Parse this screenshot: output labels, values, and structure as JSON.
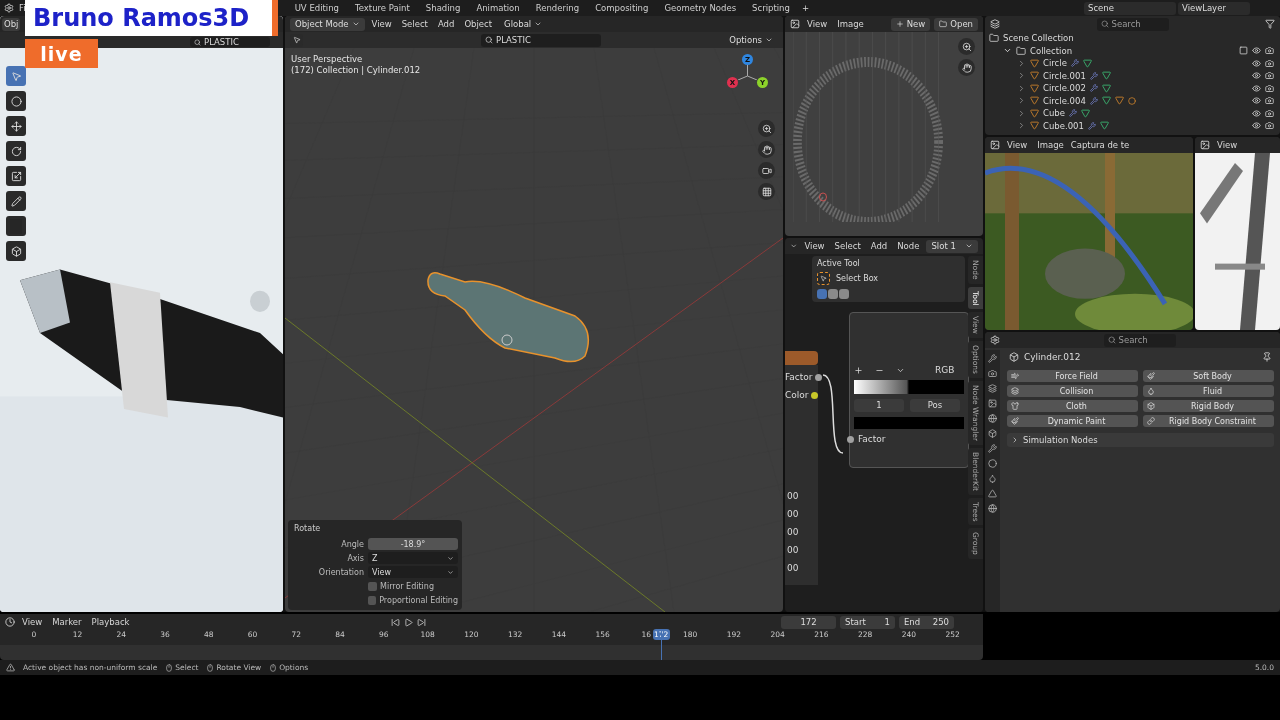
{
  "overlay": {
    "title": "Bruno Ramos3D",
    "badge": "live"
  },
  "top_bar": {
    "file_menu": "Fi",
    "workspace_tabs": [
      {
        "label": "UV Editing",
        "selected": false
      },
      {
        "label": "Texture Paint",
        "selected": false
      },
      {
        "label": "Shading",
        "selected": false
      },
      {
        "label": "Animation",
        "selected": false
      },
      {
        "label": "Rendering",
        "selected": false
      },
      {
        "label": "Compositing",
        "selected": false
      },
      {
        "label": "Geometry Nodes",
        "selected": false
      },
      {
        "label": "Scripting",
        "selected": false
      }
    ],
    "add_tab": "+",
    "scene": "Scene",
    "view_layer": "ViewLayer"
  },
  "render_viewport": {
    "mode": "Obj",
    "search": "PLASTIC"
  },
  "viewport": {
    "mode": "Object Mode",
    "menus": [
      "View",
      "Select",
      "Add",
      "Object"
    ],
    "orientation": "Global",
    "search": "PLASTIC",
    "options": "Options",
    "info": [
      "User Perspective",
      "(172) Collection | Cylinder.012"
    ],
    "gizmo": [
      "X",
      "Y",
      "Z"
    ]
  },
  "rotate_panel": {
    "title": "Rotate",
    "fields": [
      {
        "label": "Angle",
        "value": "-18.9°",
        "kind": "number"
      },
      {
        "label": "Axis",
        "value": "Z",
        "kind": "dropdown"
      },
      {
        "label": "Orientation",
        "value": "View",
        "kind": "dropdown"
      }
    ],
    "checkboxes": [
      {
        "label": "Mirror Editing",
        "checked": false
      },
      {
        "label": "Proportional Editing",
        "checked": false
      }
    ]
  },
  "image_editor": {
    "menus": [
      "View",
      "Image"
    ],
    "new": "New",
    "open": "Open"
  },
  "node_editor": {
    "menus": [
      "View",
      "Select",
      "Add",
      "Node"
    ],
    "slot": "Slot 1",
    "active_tool": {
      "title": "Active Tool",
      "tool": "Select Box"
    },
    "sockets": [
      {
        "label": "Factor",
        "color": "#a1a1a1"
      },
      {
        "label": "Color",
        "color": "#c7c729"
      }
    ],
    "ramp": {
      "mode": "RGB",
      "index": "1",
      "interpolation": "Pos"
    },
    "output": "Factor",
    "values": [
      "00",
      "00",
      "00",
      "00",
      "00"
    ],
    "side_tabs": [
      {
        "label": "Node",
        "selected": false
      },
      {
        "label": "Tool",
        "selected": true
      },
      {
        "label": "View",
        "selected": false
      },
      {
        "label": "Options",
        "selected": false
      },
      {
        "label": "Node Wrangler",
        "selected": false
      },
      {
        "label": "BlenderKit",
        "selected": false
      },
      {
        "label": "Trees",
        "selected": false
      },
      {
        "label": "Group",
        "selected": false
      }
    ]
  },
  "outliner": {
    "search_placeholder": "Search",
    "tree": [
      {
        "name": "Scene Collection",
        "kind": "root",
        "children": [
          {
            "name": "Collection",
            "kind": "collection",
            "expanded": true,
            "children": [
              {
                "name": "Circle",
                "kind": "object",
                "expanded": false,
                "material": false
              },
              {
                "name": "Circle.001",
                "kind": "object",
                "expanded": false,
                "material": false
              },
              {
                "name": "Circle.002",
                "kind": "object",
                "expanded": false,
                "material": false
              },
              {
                "name": "Circle.004",
                "kind": "object",
                "expanded": false,
                "material": true
              },
              {
                "name": "Cube",
                "kind": "object",
                "expanded": false,
                "material": false
              },
              {
                "name": "Cube.001",
                "kind": "object",
                "expanded": false,
                "material": false
              }
            ]
          }
        ]
      }
    ]
  },
  "image_views": [
    {
      "menus": [
        "View",
        "Image"
      ],
      "name": "Captura de te"
    },
    {
      "menus": [
        "View"
      ]
    }
  ],
  "properties": {
    "search_placeholder": "Search",
    "object": "Cylinder.012",
    "buttons": [
      "Force Field",
      "Soft Body",
      "Collision",
      "Fluid",
      "Cloth",
      "Rigid Body",
      "Dynamic Paint",
      "Rigid Body Constraint"
    ],
    "section": "Simulation Nodes"
  },
  "timeline": {
    "menus": [
      "View",
      "Marker",
      "Playback"
    ],
    "current": "172",
    "start_label": "Start",
    "start": "1",
    "end_label": "End",
    "end": "250",
    "ticks": [
      "0",
      "12",
      "24",
      "36",
      "48",
      "60",
      "72",
      "84",
      "96",
      "108",
      "120",
      "132",
      "144",
      "156",
      "16",
      "180",
      "192",
      "204",
      "216",
      "228",
      "240",
      "252"
    ],
    "playhead": {
      "label": "172",
      "level": 0.682
    }
  },
  "status_bar": {
    "message": "Active object has non-uniform scale",
    "hints": [
      "Select",
      "Rotate View",
      "Options"
    ],
    "version": "5.0.0"
  }
}
